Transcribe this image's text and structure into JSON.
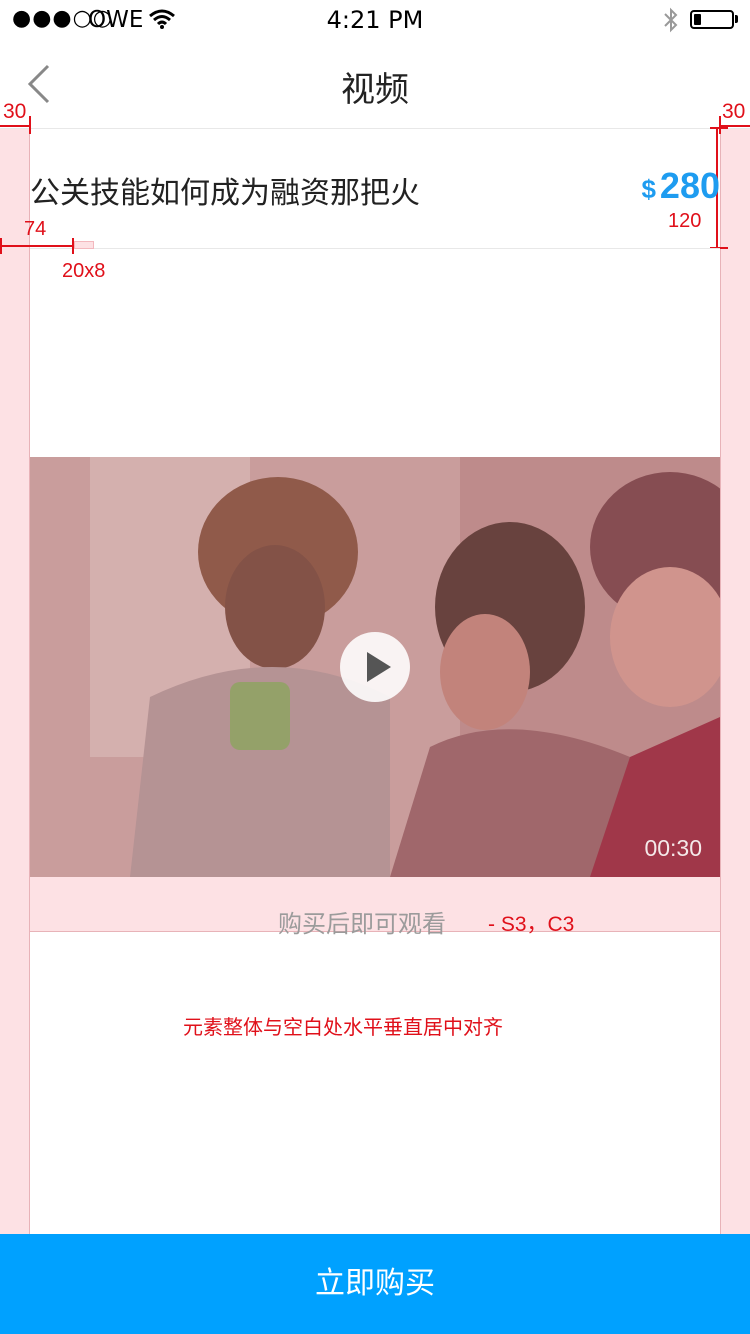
{
  "status_bar": {
    "signal": "●●●○○",
    "carrier": "OWE",
    "time": "4:21 PM",
    "battery_level": 0.2
  },
  "nav": {
    "title": "视频",
    "back_icon": "chevron-left-icon"
  },
  "course": {
    "title": "公关技能如何成为融资那把火",
    "price_symbol": "$",
    "price_value": "280"
  },
  "video": {
    "duration": "00:30",
    "play_icon": "play-icon",
    "locked_hint": "购买后即可观看"
  },
  "annotations": {
    "margin_left": "30",
    "margin_right": "30",
    "row_height": "120",
    "offset_74": "74",
    "mark_size": "20x8",
    "hint_style": "- S3，C3",
    "center_note": "元素整体与空白处水平垂直居中对齐",
    "guide_color": "#fde1e4",
    "annotation_color": "#e0101a"
  },
  "footer": {
    "buy_label": "立即购买",
    "accent_color": "#00a1ff"
  }
}
